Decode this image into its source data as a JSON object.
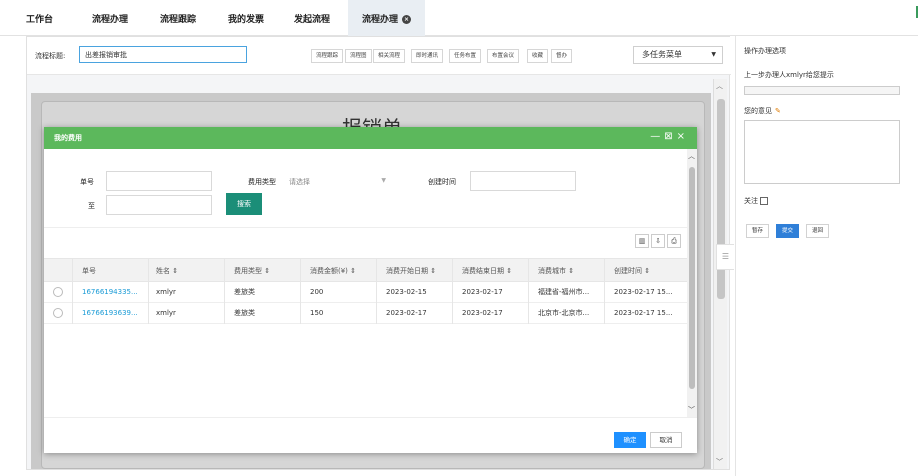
{
  "tabs": [
    {
      "label": "工作台"
    },
    {
      "label": "流程办理"
    },
    {
      "label": "流程跟踪"
    },
    {
      "label": "我的发票"
    },
    {
      "label": "发起流程"
    },
    {
      "label": "流程办理",
      "active": true
    }
  ],
  "form": {
    "title_label": "流程标题:",
    "title_value": "出差报销审批",
    "toolbar": [
      "流程跟踪",
      "流程图",
      "相关流程",
      "即时通讯",
      "任务布置",
      "布置会议",
      "收藏",
      "督办"
    ],
    "menu": "多任务菜单",
    "doc_title": "报销单"
  },
  "right_panel": {
    "header": "操作办理选项",
    "hint": "上一步办理人xmlyr给您提示",
    "opinion_label": "您的意见",
    "follow_label": "关注",
    "actions": [
      "暂存",
      "提交",
      "退回"
    ]
  },
  "modal": {
    "title": "我的费用",
    "search": {
      "order_label": "单号",
      "to_label": "至",
      "type_label": "费用类型",
      "type_placeholder": "请选择",
      "created_label": "创建时间",
      "search_button": "搜索"
    },
    "columns": [
      "单号",
      "姓名 ⇕",
      "费用类型 ⇕",
      "消费金额(¥) ⇕",
      "消费开始日期 ⇕",
      "消费结束日期 ⇕",
      "消费城市 ⇕",
      "创建时间 ⇕"
    ],
    "rows": [
      [
        "16766194335...",
        "xmlyr",
        "差旅类",
        "200",
        "2023-02-15",
        "2023-02-17",
        "福建省-福州市...",
        "2023-02-17 15..."
      ],
      [
        "16766193639...",
        "xmlyr",
        "差旅类",
        "150",
        "2023-02-17",
        "2023-02-17",
        "北京市-北京市...",
        "2023-02-17 15..."
      ]
    ],
    "confirm": "确定",
    "cancel": "取消"
  },
  "colors": {
    "modal_header": "#5cb85c",
    "search_button": "#1b8e78",
    "confirm_button": "#1e90ff",
    "link": "#1a9bd6"
  }
}
